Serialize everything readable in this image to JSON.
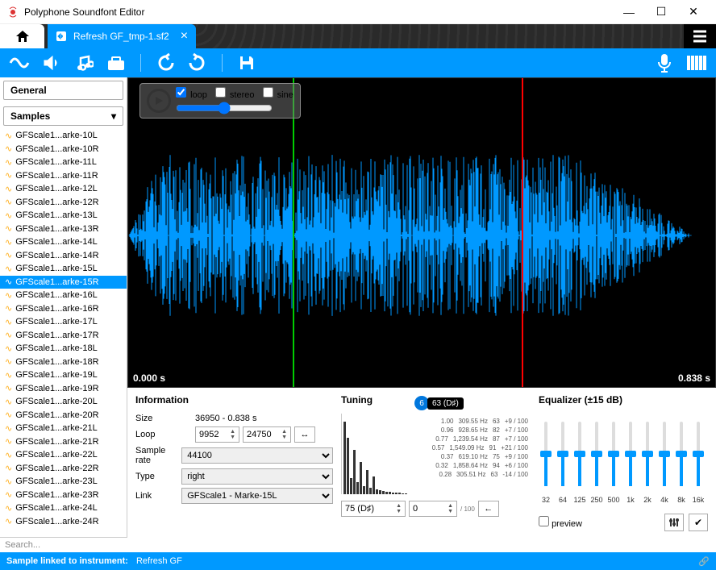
{
  "app": {
    "title": "Polyphone Soundfont Editor"
  },
  "tab": {
    "filename": "Refresh GF_tmp-1.sf2"
  },
  "sidebar": {
    "general_label": "General",
    "samples_label": "Samples",
    "items": [
      {
        "label": "GFScale1...arke-10L"
      },
      {
        "label": "GFScale1...arke-10R"
      },
      {
        "label": "GFScale1...arke-11L"
      },
      {
        "label": "GFScale1...arke-11R"
      },
      {
        "label": "GFScale1...arke-12L"
      },
      {
        "label": "GFScale1...arke-12R"
      },
      {
        "label": "GFScale1...arke-13L"
      },
      {
        "label": "GFScale1...arke-13R"
      },
      {
        "label": "GFScale1...arke-14L"
      },
      {
        "label": "GFScale1...arke-14R"
      },
      {
        "label": "GFScale1...arke-15L"
      },
      {
        "label": "GFScale1...arke-15R"
      },
      {
        "label": "GFScale1...arke-16L"
      },
      {
        "label": "GFScale1...arke-16R"
      },
      {
        "label": "GFScale1...arke-17L"
      },
      {
        "label": "GFScale1...arke-17R"
      },
      {
        "label": "GFScale1...arke-18L"
      },
      {
        "label": "GFScale1...arke-18R"
      },
      {
        "label": "GFScale1...arke-19L"
      },
      {
        "label": "GFScale1...arke-19R"
      },
      {
        "label": "GFScale1...arke-20L"
      },
      {
        "label": "GFScale1...arke-20R"
      },
      {
        "label": "GFScale1...arke-21L"
      },
      {
        "label": "GFScale1...arke-21R"
      },
      {
        "label": "GFScale1...arke-22L"
      },
      {
        "label": "GFScale1...arke-22R"
      },
      {
        "label": "GFScale1...arke-23L"
      },
      {
        "label": "GFScale1...arke-23R"
      },
      {
        "label": "GFScale1...arke-24L"
      },
      {
        "label": "GFScale1...arke-24R"
      }
    ],
    "selected_index": 11
  },
  "waveform": {
    "checks": {
      "loop": "loop",
      "stereo": "stereo",
      "sine": "sine"
    },
    "time_start": "0.000 s",
    "time_end": "0.838 s"
  },
  "info": {
    "title": "Information",
    "size_label": "Size",
    "size_value": "36950 - 0.838 s",
    "loop_label": "Loop",
    "loop_start": "9952",
    "loop_end": "24750",
    "rate_label": "Sample rate",
    "rate_value": "44100",
    "type_label": "Type",
    "type_value": "right",
    "link_label": "Link",
    "link_value": "GFScale1 - Marke-15L"
  },
  "tuning": {
    "title": "Tuning",
    "badge_num": "6",
    "badge_note": "63 (D♯)",
    "rows": [
      {
        "r": "1.00",
        "hz": "309.55 Hz",
        "k": "63",
        "c": "+9 / 100"
      },
      {
        "r": "0.96",
        "hz": "928.65 Hz",
        "k": "82",
        "c": "+7 / 100"
      },
      {
        "r": "0.77",
        "hz": "1,239.54 Hz",
        "k": "87",
        "c": "+7 / 100"
      },
      {
        "r": "0.57",
        "hz": "1,549.09 Hz",
        "k": "91",
        "c": "+21 / 100"
      },
      {
        "r": "0.37",
        "hz": "619.10 Hz",
        "k": "75",
        "c": "+9 / 100"
      },
      {
        "r": "0.32",
        "hz": "1,858.64 Hz",
        "k": "94",
        "c": "+6 / 100"
      },
      {
        "r": "0.28",
        "hz": "305.51 Hz",
        "k": "63",
        "c": "-14 / 100"
      }
    ],
    "pitch_value": "75 (D♯)",
    "cents_value": "0",
    "cents_unit": "/ 100"
  },
  "eq": {
    "title": "Equalizer (±15 dB)",
    "bands": [
      "32",
      "64",
      "125",
      "250",
      "500",
      "1k",
      "2k",
      "4k",
      "8k",
      "16k"
    ],
    "values": [
      50,
      50,
      50,
      50,
      50,
      50,
      50,
      50,
      50,
      50
    ],
    "preview_label": "preview"
  },
  "status": {
    "label": "Sample linked to instrument:",
    "value": "Refresh GF"
  },
  "search": {
    "placeholder": "Search..."
  }
}
